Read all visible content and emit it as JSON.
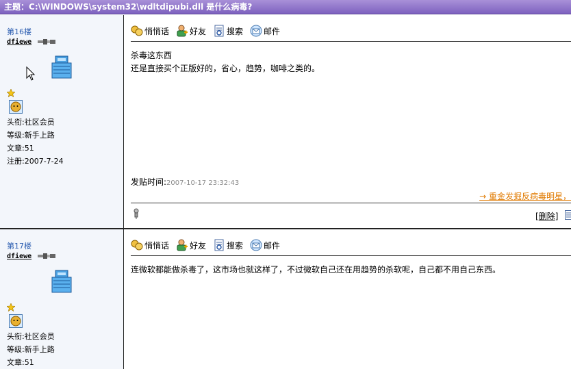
{
  "topic": {
    "label": "主题：",
    "title": "C:\\WINDOWS\\system32\\wdltdipubi.dll 是什么病毒?"
  },
  "tools": {
    "whisper": "悄悄话",
    "friend": "好友",
    "search": "搜索",
    "mail": "邮件"
  },
  "posts": [
    {
      "floor": "第16楼",
      "username": "dfiewe",
      "title_label": "头衔:社区会员",
      "level_label": "等级:新手上路",
      "articles_label": "文章:51",
      "register_label": "注册:2007-7-24",
      "line1": "杀毒这东西",
      "line2": "还是直接买个正版好的，省心，趋势，咖啡之类的。",
      "time_label": "发贴时间:",
      "time_value": "2007-10-17 23:32:43",
      "signature_link": "→ 重金发掘反病毒明星，",
      "delete_label": "删除"
    },
    {
      "floor": "第17楼",
      "username": "dfiewe",
      "title_label": "头衔:社区会员",
      "level_label": "等级:新手上路",
      "articles_label": "文章:51",
      "line1": "连微软都能做杀毒了，这市场也就这样了，不过微软自己还在用趋势的杀软呢，自己都不用自己东西。"
    }
  ],
  "colors": {
    "titlebar": "#8a6fc8",
    "sidebar_bg": "#f3f6fb",
    "floor_link": "#2a5cb0",
    "signature": "#e07a00"
  }
}
